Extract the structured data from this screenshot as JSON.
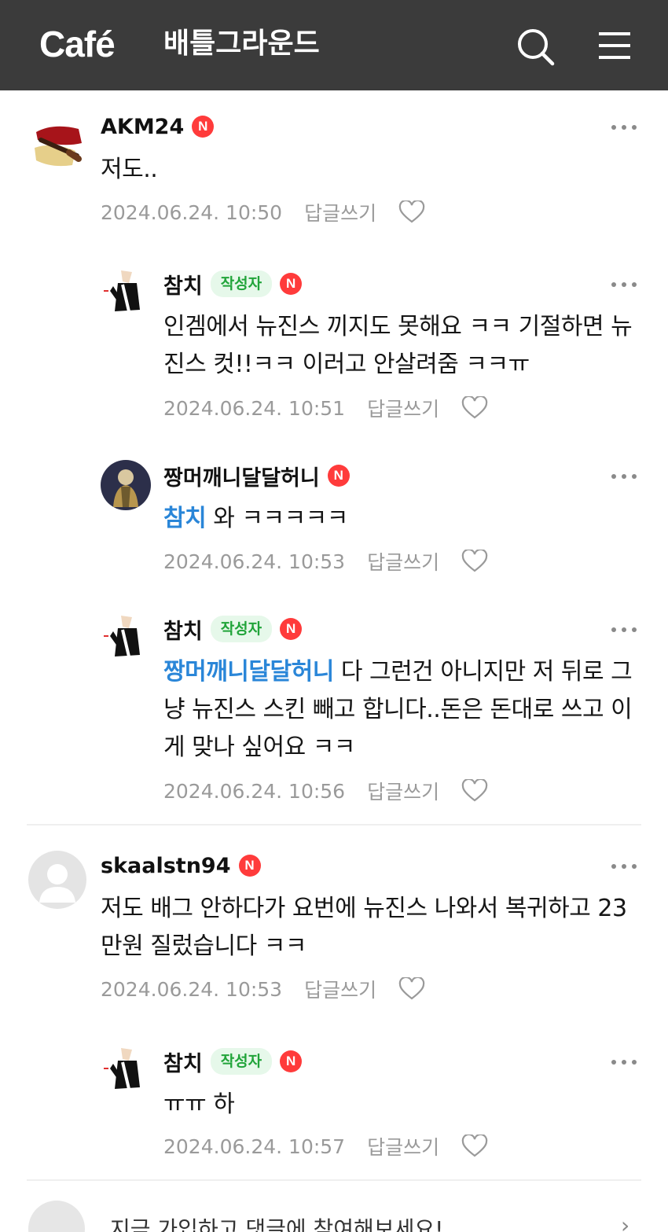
{
  "header": {
    "logo": "Café",
    "cafe_name": "배틀그라운드",
    "icons": {
      "search": "search-icon",
      "menu": "hamburger-menu-icon"
    },
    "background": "#3b3b3b"
  },
  "labels": {
    "reply": "답글쓰기",
    "author_badge": "작성자",
    "n_badge": "N"
  },
  "comments": [
    {
      "nick": "AKM24",
      "is_author": false,
      "mention": "",
      "text": "저도..",
      "date": "2024.06.24. 10:50"
    },
    {
      "nick": "참치",
      "is_author": true,
      "mention": "",
      "text": "인겜에서 뉴진스 끼지도 못해요 ㅋㅋ 기절하면 뉴진스 컷!!ㅋㅋ 이러고 안살려줌 ㅋㅋㅠ",
      "date": "2024.06.24. 10:51"
    },
    {
      "nick": "짱머깨니달달허니",
      "is_author": false,
      "mention": "참치",
      "text": " 와 ㅋㅋㅋㅋㅋ",
      "date": "2024.06.24. 10:53"
    },
    {
      "nick": "참치",
      "is_author": true,
      "mention": "짱머깨니달달허니",
      "text": " 다 그런건 아니지만 저 뒤로 그냥 뉴진스 스킨 빼고 합니다..돈은 돈대로 쓰고 이게 맞나 싶어요 ㅋㅋ",
      "date": "2024.06.24. 10:56"
    },
    {
      "nick": "skaalstn94",
      "is_author": false,
      "mention": "",
      "text": "저도 배그 안하다가 요번에 뉴진스 나와서 복귀하고 23만원 질렀습니다 ㅋㅋ",
      "date": "2024.06.24. 10:53"
    },
    {
      "nick": "참치",
      "is_author": true,
      "mention": "",
      "text": "ㅠㅠ 하",
      "date": "2024.06.24. 10:57"
    }
  ],
  "footer": {
    "prompt": "지금 가입하고 댓글에 참여해보세요!",
    "chevron": "chevron-right-icon"
  },
  "colors": {
    "mention": "#2a86d8",
    "author_badge_text": "#21a43a",
    "author_badge_bg": "#e6f8ea",
    "n_badge": "#ff3b3b",
    "meta_text": "#9a9a9a"
  }
}
